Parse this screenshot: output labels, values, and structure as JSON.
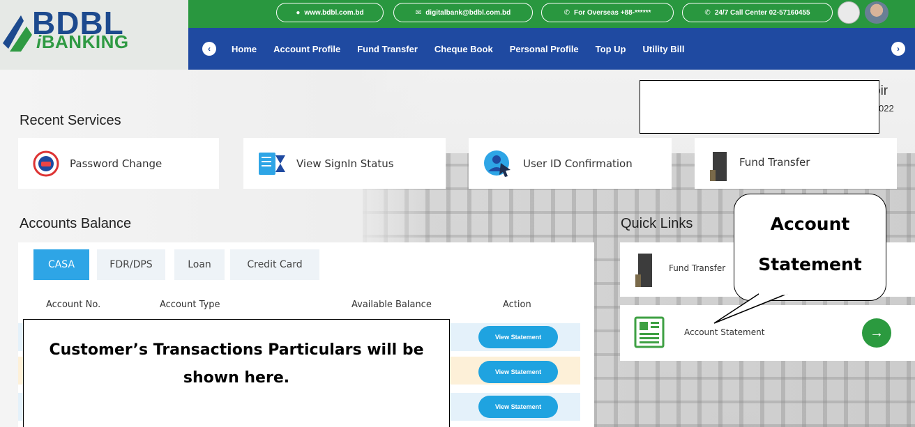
{
  "brand": {
    "logo_main": "BDBL",
    "logo_sub_i": "i",
    "logo_sub_rest": "BANKING"
  },
  "topbar": {
    "website": "www.bdbl.com.bd",
    "email": "digitalbank@bdbl.com.bd",
    "overseas": "For Overseas +88-******",
    "call_center": "24/7 Call Center 02-57160455"
  },
  "nav": {
    "items": [
      "Home",
      "Account Profile",
      "Fund Transfer",
      "Cheque Book",
      "Personal Profile",
      "Top Up",
      "Utility Bill"
    ],
    "prev": "‹",
    "next": "›"
  },
  "user": {
    "name_tail": "bir",
    "date_tail": "022"
  },
  "recent_services": {
    "title": "Recent Services",
    "items": [
      {
        "label": "Password Change",
        "icon": "password-change-icon"
      },
      {
        "label": "View SignIn Status",
        "icon": "signin-status-icon"
      },
      {
        "label": "User ID Confirmation",
        "icon": "user-id-icon"
      },
      {
        "label": "Fund Transfer",
        "icon": "building-icon"
      }
    ]
  },
  "accounts": {
    "title": "Accounts Balance",
    "tabs": [
      "CASA",
      "FDR/DPS",
      "Loan",
      "Credit Card"
    ],
    "active_tab": "CASA",
    "columns": [
      "Account No.",
      "Account Type",
      "Available Balance",
      "Action"
    ],
    "row_action": "View Statement",
    "placeholder_text": "Customer’s Transactions Particulars will be shown here."
  },
  "quick_links": {
    "title": "Quick Links",
    "items": [
      {
        "label": "Fund Transfer",
        "icon": "building-icon"
      },
      {
        "label": "Account Statement",
        "icon": "statement-icon"
      }
    ],
    "go": "→"
  },
  "callout": {
    "line1": "Account",
    "line2": "Statement"
  },
  "colors": {
    "green": "#29973f",
    "navy": "#1f4aa1",
    "blue": "#2ea5e6"
  }
}
